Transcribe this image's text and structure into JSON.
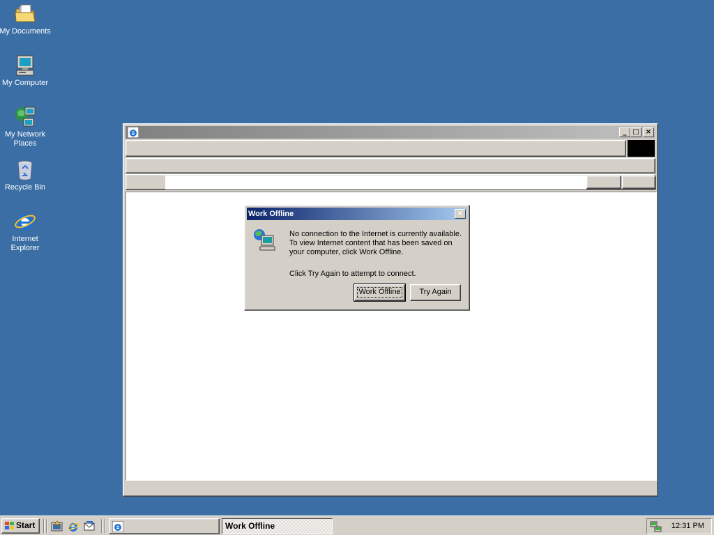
{
  "desktop": {
    "icons": [
      {
        "label_lines": [
          "My Documents"
        ],
        "icon": "folder-documents-icon"
      },
      {
        "label_lines": [
          "My Computer"
        ],
        "icon": "computer-icon"
      },
      {
        "label_lines": [
          "My Network",
          "Places"
        ],
        "icon": "network-places-icon"
      },
      {
        "label_lines": [
          "Recycle Bin"
        ],
        "icon": "recycle-bin-icon"
      },
      {
        "label_lines": [
          "Internet",
          "Explorer"
        ],
        "icon": "internet-explorer-icon"
      }
    ]
  },
  "ie_window": {
    "title": "",
    "address_value": ""
  },
  "dialog": {
    "title": "Work Offline",
    "message_lines": [
      "No connection to the Internet is currently available.",
      "To view Internet content that has been saved on",
      "your computer, click Work Offline."
    ],
    "hint": "Click Try Again to attempt to connect.",
    "work_offline_label": "Work Offline",
    "try_again_label": "Try Again"
  },
  "taskbar": {
    "start_label": "Start",
    "quick_launch": [
      "show-desktop-icon",
      "internet-explorer-icon",
      "outlook-express-icon"
    ],
    "tasks": [
      {
        "label": "",
        "icon": "internet-explorer-icon"
      },
      {
        "label": "Work Offline",
        "active": true
      }
    ],
    "clock": "12:31 PM"
  },
  "colors": {
    "desktop": "#3a6ea5",
    "active_title_start": "#0a246a",
    "active_title_end": "#a6caf0",
    "inactive_title_start": "#808080",
    "inactive_title_end": "#c0c0c0",
    "face": "#d4d0c8"
  }
}
